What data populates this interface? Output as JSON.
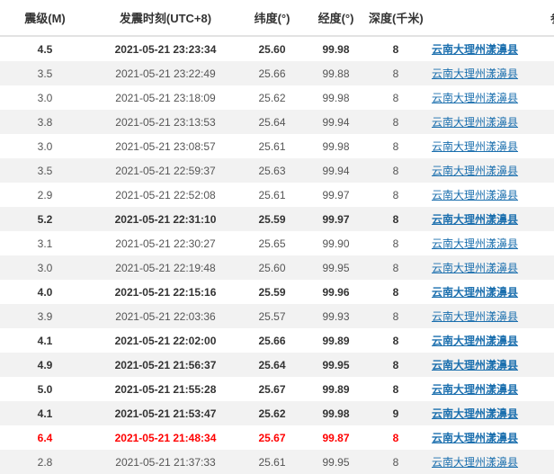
{
  "headers": {
    "magnitude": "震级(M)",
    "time": "发震时刻(UTC+8)",
    "latitude": "纬度(°)",
    "longitude": "经度(°)",
    "depth": "深度(千米)",
    "reference": "参考"
  },
  "rows": [
    {
      "mag": "4.5",
      "time": "2021-05-21 23:23:34",
      "lat": "25.60",
      "lon": "99.98",
      "depth": "8",
      "location": "云南大理州漾濞县",
      "style": "strong"
    },
    {
      "mag": "3.5",
      "time": "2021-05-21 23:22:49",
      "lat": "25.66",
      "lon": "99.88",
      "depth": "8",
      "location": "云南大理州漾濞县",
      "style": "normal"
    },
    {
      "mag": "3.0",
      "time": "2021-05-21 23:18:09",
      "lat": "25.62",
      "lon": "99.98",
      "depth": "8",
      "location": "云南大理州漾濞县",
      "style": "normal"
    },
    {
      "mag": "3.8",
      "time": "2021-05-21 23:13:53",
      "lat": "25.64",
      "lon": "99.94",
      "depth": "8",
      "location": "云南大理州漾濞县",
      "style": "normal"
    },
    {
      "mag": "3.0",
      "time": "2021-05-21 23:08:57",
      "lat": "25.61",
      "lon": "99.98",
      "depth": "8",
      "location": "云南大理州漾濞县",
      "style": "normal"
    },
    {
      "mag": "3.5",
      "time": "2021-05-21 22:59:37",
      "lat": "25.63",
      "lon": "99.94",
      "depth": "8",
      "location": "云南大理州漾濞县",
      "style": "normal"
    },
    {
      "mag": "2.9",
      "time": "2021-05-21 22:52:08",
      "lat": "25.61",
      "lon": "99.97",
      "depth": "8",
      "location": "云南大理州漾濞县",
      "style": "normal"
    },
    {
      "mag": "5.2",
      "time": "2021-05-21 22:31:10",
      "lat": "25.59",
      "lon": "99.97",
      "depth": "8",
      "location": "云南大理州漾濞县",
      "style": "strong"
    },
    {
      "mag": "3.1",
      "time": "2021-05-21 22:30:27",
      "lat": "25.65",
      "lon": "99.90",
      "depth": "8",
      "location": "云南大理州漾濞县",
      "style": "normal"
    },
    {
      "mag": "3.0",
      "time": "2021-05-21 22:19:48",
      "lat": "25.60",
      "lon": "99.95",
      "depth": "8",
      "location": "云南大理州漾濞县",
      "style": "normal"
    },
    {
      "mag": "4.0",
      "time": "2021-05-21 22:15:16",
      "lat": "25.59",
      "lon": "99.96",
      "depth": "8",
      "location": "云南大理州漾濞县",
      "style": "strong"
    },
    {
      "mag": "3.9",
      "time": "2021-05-21 22:03:36",
      "lat": "25.57",
      "lon": "99.93",
      "depth": "8",
      "location": "云南大理州漾濞县",
      "style": "normal"
    },
    {
      "mag": "4.1",
      "time": "2021-05-21 22:02:00",
      "lat": "25.66",
      "lon": "99.89",
      "depth": "8",
      "location": "云南大理州漾濞县",
      "style": "strong"
    },
    {
      "mag": "4.9",
      "time": "2021-05-21 21:56:37",
      "lat": "25.64",
      "lon": "99.95",
      "depth": "8",
      "location": "云南大理州漾濞县",
      "style": "strong"
    },
    {
      "mag": "5.0",
      "time": "2021-05-21 21:55:28",
      "lat": "25.67",
      "lon": "99.89",
      "depth": "8",
      "location": "云南大理州漾濞县",
      "style": "strong"
    },
    {
      "mag": "4.1",
      "time": "2021-05-21 21:53:47",
      "lat": "25.62",
      "lon": "99.98",
      "depth": "9",
      "location": "云南大理州漾濞县",
      "style": "strong"
    },
    {
      "mag": "6.4",
      "time": "2021-05-21 21:48:34",
      "lat": "25.67",
      "lon": "99.87",
      "depth": "8",
      "location": "云南大理州漾濞县",
      "style": "major"
    },
    {
      "mag": "2.8",
      "time": "2021-05-21 21:37:33",
      "lat": "25.61",
      "lon": "99.95",
      "depth": "8",
      "location": "云南大理州漾濞县",
      "style": "normal"
    }
  ],
  "colors": {
    "header_text": "#333333",
    "row_alt_bg": "#f2f2f2",
    "major_quake": "#ff0000",
    "link": "#1b6fae"
  }
}
